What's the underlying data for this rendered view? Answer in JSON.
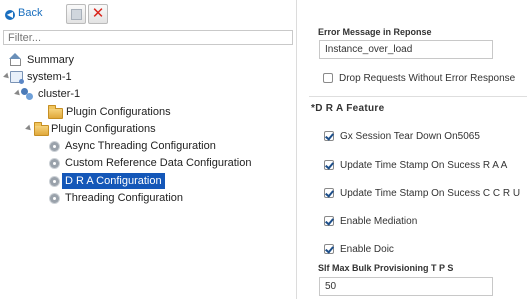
{
  "toolbar": {
    "back_label": "Back",
    "save_icon": "save-icon",
    "delete_icon": "delete-icon"
  },
  "filter": {
    "placeholder": "Filter..."
  },
  "tree": {
    "items": [
      {
        "label": "Summary",
        "icon": "house-icon"
      },
      {
        "label": "system-1",
        "icon": "system-icon"
      },
      {
        "label": "cluster-1",
        "icon": "cluster-icon"
      },
      {
        "label": "Plugin Configurations",
        "icon": "folder-icon"
      },
      {
        "label": "Plugin Configurations",
        "icon": "folder-icon"
      },
      {
        "label": "Async Threading Configuration",
        "icon": "gear-icon"
      },
      {
        "label": "Custom Reference Data Configuration",
        "icon": "gear-icon"
      },
      {
        "label": "D R A Configuration",
        "icon": "gear-icon",
        "selected": true
      },
      {
        "label": "Threading Configuration",
        "icon": "gear-icon"
      }
    ]
  },
  "form": {
    "error_message_label": "Error Message in Reponse",
    "error_message_value": "Instance_over_load",
    "drop_requests_label": "Drop Requests Without Error Response",
    "drop_requests_checked": false,
    "section_title": "*D R A Feature",
    "checkboxes": [
      {
        "label": "Gx Session Tear Down On5065",
        "checked": true
      },
      {
        "label": "Update Time Stamp On Sucess R A A",
        "checked": true
      },
      {
        "label": "Update Time Stamp On Sucess C C R U",
        "checked": true
      },
      {
        "label": "Enable Mediation",
        "checked": true
      },
      {
        "label": "Enable Doic",
        "checked": true
      }
    ],
    "slf_label": "Slf Max Bulk Provisioning T P S",
    "slf_value": "50"
  },
  "colors": {
    "selection": "#1457b8",
    "link": "#1a6fbf",
    "delete": "#d9261c"
  }
}
